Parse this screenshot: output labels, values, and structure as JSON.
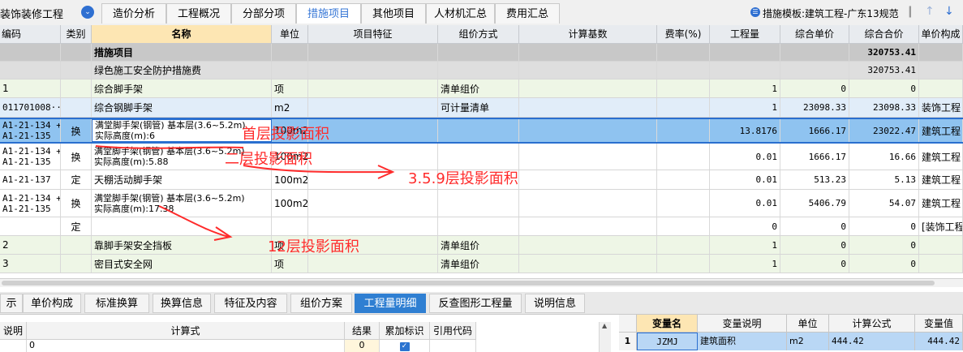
{
  "top": {
    "project_title": "装饰装修工程",
    "tabs": [
      "造价分析",
      "工程概况",
      "分部分项",
      "措施项目",
      "其他项目",
      "人材机汇总",
      "费用汇总"
    ],
    "active_tab": "措施项目",
    "template_label": "措施模板:建筑工程-广东13规范"
  },
  "grid": {
    "headers": [
      "编码",
      "类别",
      "名称",
      "单位",
      "项目特征",
      "组价方式",
      "计算基数",
      "费率(%)",
      "工程量",
      "综合单价",
      "综合合价",
      "单价构成"
    ],
    "rows": [
      {
        "code": "",
        "type": "",
        "name": "措施项目",
        "unit": "",
        "feature": "",
        "method": "",
        "base": "",
        "rate": "",
        "qty": "",
        "unit_price": "",
        "total": "320753.41",
        "comp": ""
      },
      {
        "code": "",
        "type": "",
        "name": "绿色施工安全防护措施费",
        "unit": "",
        "feature": "",
        "method": "",
        "base": "",
        "rate": "",
        "qty": "",
        "unit_price": "",
        "total": "320753.41",
        "comp": ""
      },
      {
        "code": "1",
        "type": "",
        "name": "综合脚手架",
        "unit": "项",
        "feature": "",
        "method": "清单组价",
        "base": "",
        "rate": "",
        "qty": "1",
        "unit_price": "0",
        "total": "0",
        "comp": ""
      },
      {
        "code": "011701008···",
        "type": "",
        "name": "综合钢脚手架",
        "unit": "m2",
        "feature": "",
        "method": "可计量清单",
        "base": "",
        "rate": "",
        "qty": "1",
        "unit_price": "23098.33",
        "total": "23098.33",
        "comp": "装饰工程"
      },
      {
        "code": "A1-21-134 +\nA1-21-135",
        "type": "换",
        "name": "满堂脚手架(钢管) 基本层(3.6~5.2m)\n实际高度(m):6",
        "unit": "100m2",
        "feature": "",
        "method": "",
        "base": "",
        "rate": "",
        "qty": "13.8176",
        "unit_price": "1666.17",
        "total": "23022.47",
        "comp": "建筑工程"
      },
      {
        "code": "A1-21-134 +\nA1-21-135",
        "type": "换",
        "name": "满堂脚手架(钢管) 基本层(3.6~5.2m)\n实际高度(m):5.88",
        "unit": "100m2",
        "feature": "",
        "method": "",
        "base": "",
        "rate": "",
        "qty": "0.01",
        "unit_price": "1666.17",
        "total": "16.66",
        "comp": "建筑工程"
      },
      {
        "code": "A1-21-137",
        "type": "定",
        "name": "天棚活动脚手架",
        "unit": "100m2",
        "feature": "",
        "method": "",
        "base": "",
        "rate": "",
        "qty": "0.01",
        "unit_price": "513.23",
        "total": "5.13",
        "comp": "建筑工程"
      },
      {
        "code": "A1-21-134 +\nA1-21-135",
        "type": "换",
        "name": "满堂脚手架(钢管) 基本层(3.6~5.2m)\n实际高度(m):17.38",
        "unit": "100m2",
        "feature": "",
        "method": "",
        "base": "",
        "rate": "",
        "qty": "0.01",
        "unit_price": "5406.79",
        "total": "54.07",
        "comp": "建筑工程"
      },
      {
        "code": "",
        "type": "定",
        "name": "",
        "unit": "",
        "feature": "",
        "method": "",
        "base": "",
        "rate": "",
        "qty": "0",
        "unit_price": "0",
        "total": "0",
        "comp": "[装饰工程"
      },
      {
        "code": "2",
        "type": "",
        "name": "靠脚手架安全挡板",
        "unit": "项",
        "feature": "",
        "method": "清单组价",
        "base": "",
        "rate": "",
        "qty": "1",
        "unit_price": "0",
        "total": "0",
        "comp": ""
      },
      {
        "code": "3",
        "type": "",
        "name": "密目式安全网",
        "unit": "项",
        "feature": "",
        "method": "清单组价",
        "base": "",
        "rate": "",
        "qty": "1",
        "unit_price": "0",
        "total": "0",
        "comp": ""
      }
    ]
  },
  "bottom": {
    "tabs": [
      "示",
      "单价构成",
      "标准换算",
      "换算信息",
      "特征及内容",
      "组价方案",
      "工程量明细",
      "反查图形工程量",
      "说明信息"
    ],
    "active_tab": "工程量明细",
    "detail_headers": [
      "说明",
      "计算式",
      "结果",
      "累加标识",
      "引用代码"
    ],
    "detail_row": {
      "desc": "0",
      "result": "0",
      "accumulate": true
    },
    "var_headers": [
      "",
      "变量名",
      "变量说明",
      "单位",
      "计算公式",
      "变量值"
    ],
    "var_row": {
      "index": "1",
      "name": "JZMJ",
      "desc": "建筑面积",
      "unit": "m2",
      "formula": "444.42",
      "value": "444.42"
    }
  },
  "annotations": [
    "首层投影面积",
    "二层投影面积",
    "3.5.9层投影面积",
    "12层投影面积"
  ],
  "colors": {
    "active_tab": "#3777d6",
    "selected_row": "#8fc3f0",
    "annotation": "#ff2b2b",
    "bottom_tab_active": "#2f7fd2"
  }
}
